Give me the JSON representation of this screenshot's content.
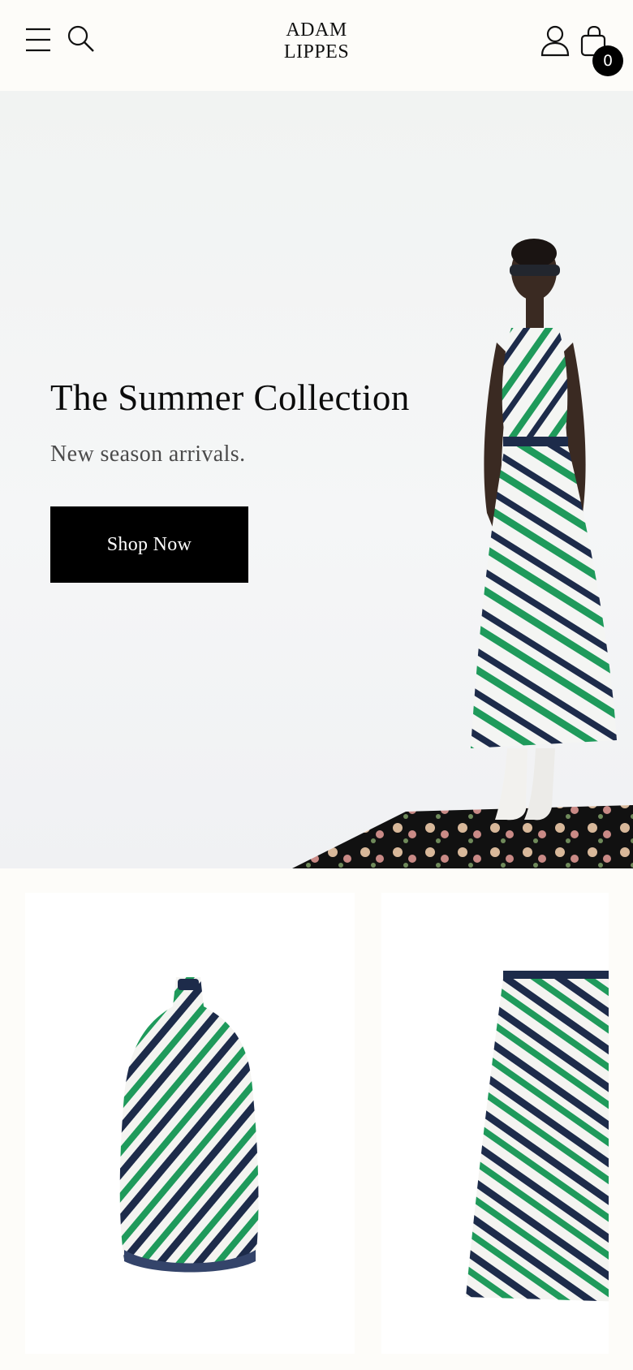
{
  "header": {
    "brand": {
      "line1": "ADAM",
      "line2": "LIPPES"
    },
    "icons": {
      "menu": "menu-icon",
      "search": "search-icon",
      "account": "user-icon",
      "cart": "bag-icon"
    },
    "cart_count": "0"
  },
  "hero": {
    "title": "The Summer Collection",
    "subtitle": "New season arrivals.",
    "cta_label": "Shop Now"
  },
  "products": {
    "items": [
      {
        "image": "striped-halter-top"
      },
      {
        "image": "striped-maxi-skirt"
      }
    ]
  },
  "colors": {
    "background": "#fdfcf9",
    "stripe_green": "#1f9a5b",
    "stripe_navy": "#1d2b4a",
    "button": "#000000"
  }
}
